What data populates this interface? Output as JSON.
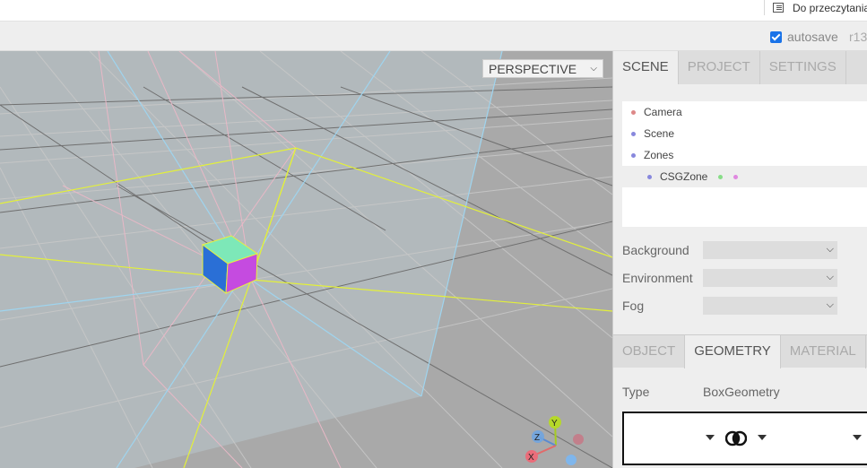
{
  "browser": {
    "reading_list_label": "Do przeczytania"
  },
  "menubar": {
    "autosave_label": "autosave",
    "autosave_checked": true,
    "version": "r13"
  },
  "viewport": {
    "camera_select_value": "PERSPECTIVE",
    "gizmo_labels": {
      "x": "X",
      "y": "Y",
      "z": "Z"
    }
  },
  "sidebar": {
    "tabs": [
      {
        "label": "SCENE",
        "active": true
      },
      {
        "label": "PROJECT",
        "active": false
      },
      {
        "label": "SETTINGS",
        "active": false
      }
    ],
    "outliner": [
      {
        "label": "Camera",
        "dot_color": "#dd8888",
        "indent": 0,
        "selected": false
      },
      {
        "label": "Scene",
        "dot_color": "#8888dd",
        "indent": 0,
        "selected": false
      },
      {
        "label": "Zones",
        "dot_color": "#8888dd",
        "indent": 0,
        "selected": false
      },
      {
        "label": "CSGZone",
        "dot_color": "#8888dd",
        "indent": 1,
        "selected": true,
        "extra_dots": [
          "#88dd88",
          "#e088e0"
        ]
      }
    ],
    "properties": [
      {
        "label": "Background",
        "value": ""
      },
      {
        "label": "Environment",
        "value": ""
      },
      {
        "label": "Fog",
        "value": ""
      }
    ],
    "object_tabs": [
      {
        "label": "OBJECT",
        "active": false
      },
      {
        "label": "GEOMETRY",
        "active": true
      },
      {
        "label": "MATERIAL",
        "active": false
      }
    ],
    "geometry": {
      "type_label": "Type",
      "type_value": "BoxGeometry"
    }
  },
  "colors": {
    "accent": "#1a73e8",
    "viewport_bg": "#aaaaaa",
    "sidebar_bg": "#eeeeee"
  }
}
